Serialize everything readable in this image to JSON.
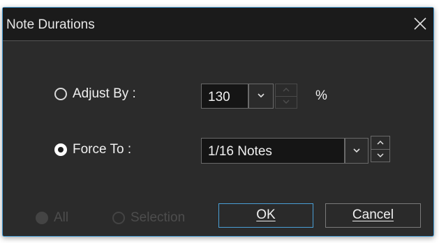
{
  "dialog": {
    "title": "Note Durations",
    "close_icon": "close-icon"
  },
  "adjust": {
    "label": "Adjust By :",
    "checked": false,
    "value": "130",
    "unit": "%"
  },
  "force": {
    "label": "Force To :",
    "checked": true,
    "value": "1/16 Notes"
  },
  "scope": {
    "all_label": "All",
    "all_checked": true,
    "all_enabled": false,
    "selection_label": "Selection",
    "selection_checked": false,
    "selection_enabled": false
  },
  "buttons": {
    "ok_label": "OK",
    "cancel_label": "Cancel"
  },
  "colors": {
    "dialog_bg": "#2b2b2b",
    "titlebar_bg": "#1b1b1b",
    "accent": "#4a9fd6",
    "text": "#f0f0f0",
    "disabled_text": "#4d4d4d"
  }
}
